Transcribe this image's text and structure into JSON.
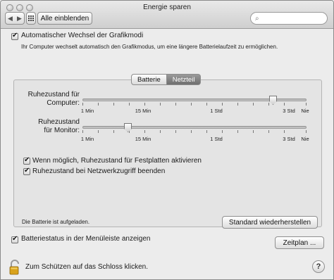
{
  "window": {
    "title": "Energie sparen"
  },
  "toolbar": {
    "show_all_label": "Alle einblenden"
  },
  "graphics": {
    "checkbox_label": "Automatischer Wechsel der Grafikmodi",
    "checked": true,
    "description": "Ihr Computer wechselt automatisch den Grafikmodus, um eine längere Batterielaufzeit zu ermöglichen."
  },
  "tabs": [
    {
      "label": "Batterie",
      "selected": false
    },
    {
      "label": "Netzteil",
      "selected": true
    }
  ],
  "sliders": {
    "tick_labels": [
      "1 Min",
      "15 Min",
      "1 Std",
      "3 Std",
      "Nie"
    ],
    "computer": {
      "label_line1": "Ruhezustand für",
      "label_line2": "Computer:",
      "value_label": "3 Std"
    },
    "monitor": {
      "label_line1": "Ruhezustand",
      "label_line2": "für Monitor:",
      "value_label": "15 Min"
    }
  },
  "options": {
    "disk_sleep": {
      "label": "Wenn möglich, Ruhezustand für Festplatten aktivieren",
      "checked": true
    },
    "network_wake": {
      "label": "Ruhezustand bei Netzwerkzugriff beenden",
      "checked": true
    }
  },
  "status": {
    "battery_text": "Die Batterie ist aufgeladen."
  },
  "buttons": {
    "restore_defaults": "Standard wiederherstellen",
    "schedule": "Zeitplan ...",
    "help": "?"
  },
  "menubar_option": {
    "label": "Batteriestatus in der Menüleiste anzeigen",
    "checked": true
  },
  "lock": {
    "text": "Zum Schützen auf das Schloss klicken."
  },
  "icons": [
    "lock-icon",
    "help-icon",
    "grid-icon",
    "back-arrow-icon",
    "forward-arrow-icon",
    "search-icon"
  ]
}
